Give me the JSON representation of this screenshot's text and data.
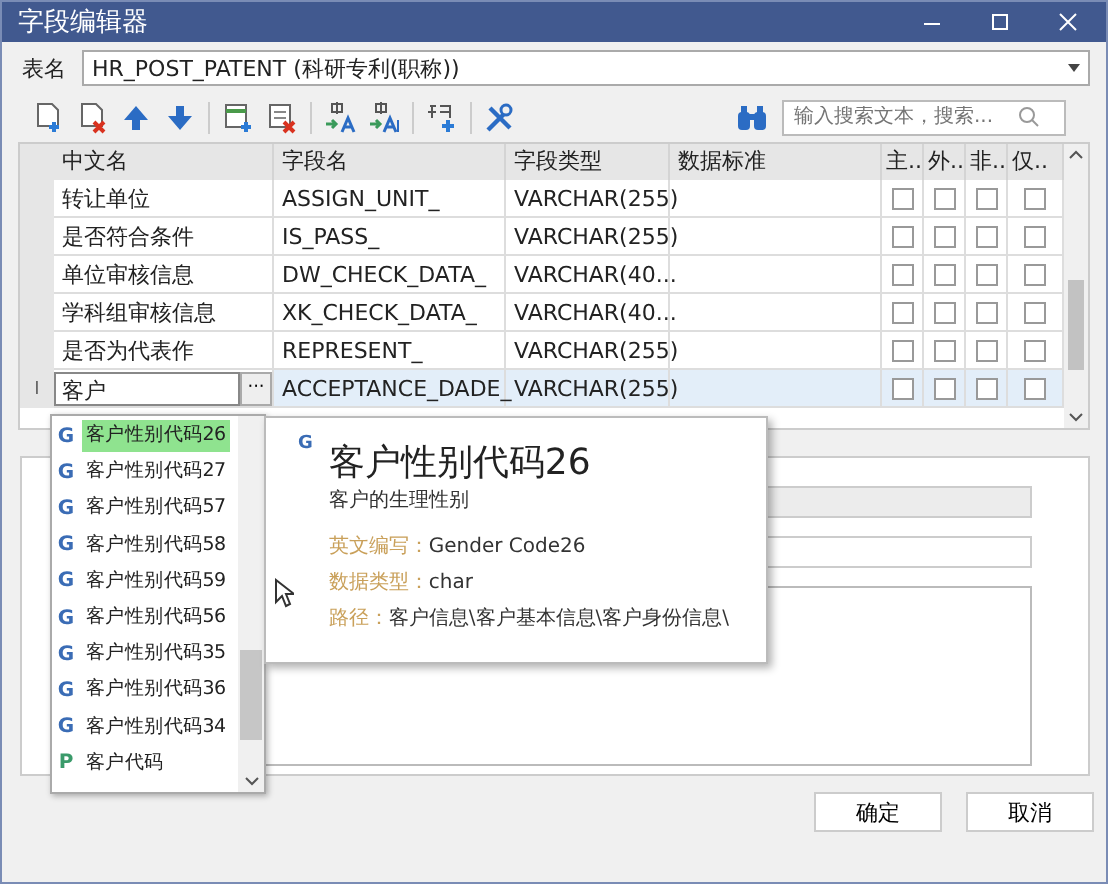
{
  "window": {
    "title": "字段编辑器"
  },
  "table_name": {
    "label": "表名",
    "value": "HR_POST_PATENT (科研专利(职称))"
  },
  "toolbar": [
    {
      "kind": "add-row"
    },
    {
      "kind": "delete-row"
    },
    {
      "kind": "up"
    },
    {
      "kind": "down"
    },
    {
      "kind": "sep"
    },
    {
      "kind": "add-col"
    },
    {
      "kind": "delete-col"
    },
    {
      "kind": "sep"
    },
    {
      "kind": "translate"
    },
    {
      "kind": "translate-all"
    },
    {
      "kind": "sep"
    },
    {
      "kind": "insert-word"
    },
    {
      "kind": "sep"
    },
    {
      "kind": "tools"
    }
  ],
  "search": {
    "placeholder": "输入搜索文本，搜索..."
  },
  "grid": {
    "columns": [
      "中文名",
      "字段名",
      "字段类型",
      "数据标准",
      "主..",
      "外..",
      "非..",
      "仅.."
    ],
    "rows": [
      {
        "name": "转让单位",
        "field": "ASSIGN_UNIT_",
        "type": "VARCHAR(255)",
        "standard": "",
        "flags": [
          false,
          false,
          false,
          false
        ],
        "selected": false
      },
      {
        "name": "是否符合条件",
        "field": "IS_PASS_",
        "type": "VARCHAR(255)",
        "standard": "",
        "flags": [
          false,
          false,
          false,
          false
        ],
        "selected": false
      },
      {
        "name": "单位审核信息",
        "field": "DW_CHECK_DATA_",
        "type": "VARCHAR(40...",
        "standard": "",
        "flags": [
          false,
          false,
          false,
          false
        ],
        "selected": false
      },
      {
        "name": "学科组审核信息",
        "field": "XK_CHECK_DATA_",
        "type": "VARCHAR(40...",
        "standard": "",
        "flags": [
          false,
          false,
          false,
          false
        ],
        "selected": false
      },
      {
        "name": "是否为代表作",
        "field": "REPRESENT_",
        "type": "VARCHAR(255)",
        "standard": "",
        "flags": [
          false,
          false,
          false,
          false
        ],
        "selected": false
      },
      {
        "name": "客户",
        "field": "ACCEPTANCE_DADE_",
        "type": "VARCHAR(255)",
        "standard": "",
        "flags": [
          false,
          false,
          false,
          false
        ],
        "selected": true,
        "editing": true,
        "indicator": "I",
        "browse": "···"
      }
    ]
  },
  "suggestions": [
    {
      "badge": "G",
      "kind": "global",
      "text": "客户性别代码26",
      "selected": true
    },
    {
      "badge": "G",
      "kind": "global",
      "text": "客户性别代码27",
      "selected": false
    },
    {
      "badge": "G",
      "kind": "global",
      "text": "客户性别代码57",
      "selected": false
    },
    {
      "badge": "G",
      "kind": "global",
      "text": "客户性别代码58",
      "selected": false
    },
    {
      "badge": "G",
      "kind": "global",
      "text": "客户性别代码59",
      "selected": false
    },
    {
      "badge": "G",
      "kind": "global",
      "text": "客户性别代码56",
      "selected": false
    },
    {
      "badge": "G",
      "kind": "global",
      "text": "客户性别代码35",
      "selected": false
    },
    {
      "badge": "G",
      "kind": "global",
      "text": "客户性别代码36",
      "selected": false
    },
    {
      "badge": "G",
      "kind": "global",
      "text": "客户性别代码34",
      "selected": false
    },
    {
      "badge": "P",
      "kind": "private",
      "text": "客户代码",
      "selected": false
    }
  ],
  "tooltip": {
    "badge": "G",
    "title": "客户性别代码26",
    "description": "客户的生理性别",
    "fields": [
      {
        "label": "英文编写：",
        "value": "Gender Code26"
      },
      {
        "label": "数据类型：",
        "value": "char"
      },
      {
        "label": "路径：",
        "value": "客户信息\\客户基本信息\\客户身份信息\\"
      }
    ]
  },
  "buttons": [
    "确定",
    "取消"
  ]
}
